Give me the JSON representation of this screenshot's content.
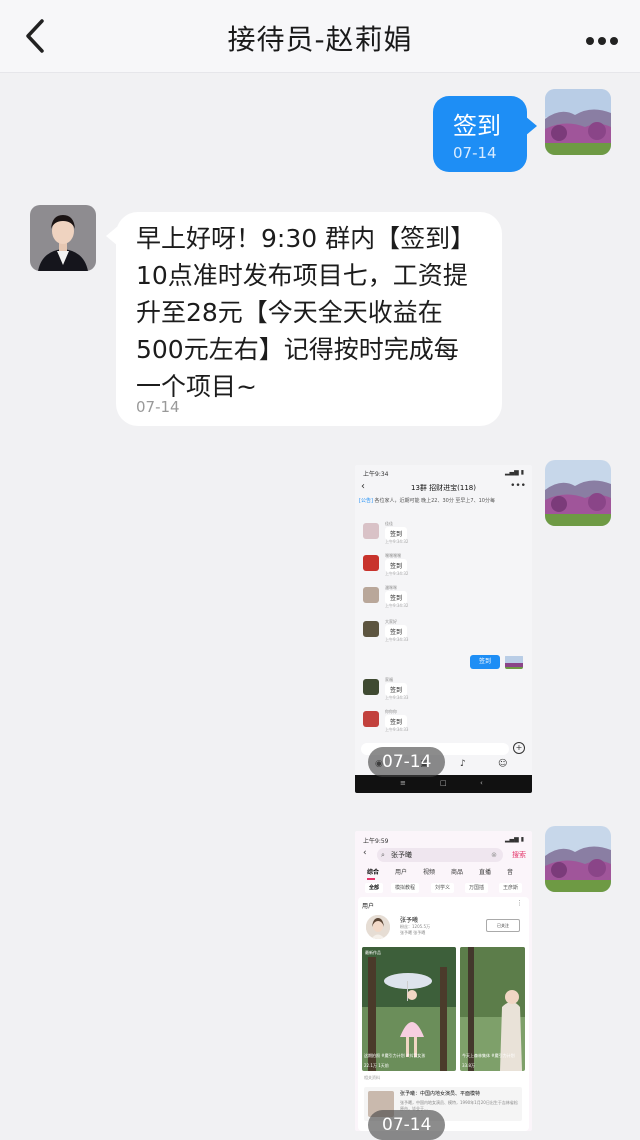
{
  "header": {
    "title": "接待员-赵莉娟"
  },
  "messages": {
    "checkin": {
      "text": "签到",
      "time": "07-14"
    },
    "greeting": {
      "lines": [
        "早上好呀！9:30 群内【签到】",
        "10点准时发布项目七，工资提",
        "升至28元【今天全天收益在",
        "500元左右】记得按时完成每",
        "一个项目~"
      ],
      "time": "07-14"
    },
    "image1_time": "07-14",
    "image2_time": "07-14"
  },
  "screenshot1": {
    "status_time": "上午9:34",
    "title": "13群 招财进宝(118)",
    "notice_tag": "[公告]",
    "notice": "各位家人，近期可能 晚上22、30分 至早上7、10分每",
    "rows": [
      {
        "name": "佳佳",
        "msg": "签到",
        "sub": "上午9:34:32"
      },
      {
        "name": "嘿嘿嘿嘿",
        "msg": "签到",
        "sub": "上午9:34:32"
      },
      {
        "name": "潘咪咪",
        "msg": "签到",
        "sub": "上午9:34:32"
      },
      {
        "name": "大家好",
        "msg": "签到",
        "sub": "上午9:34:33"
      },
      {
        "name": "家福",
        "msg": "签到",
        "sub": "上午9:34:33"
      },
      {
        "name": "你你你",
        "msg": "签到",
        "sub": "上午9:34:33"
      }
    ],
    "my_msg": "签到",
    "plus": "+"
  },
  "screenshot2": {
    "status_time": "上午9:59",
    "query": "张予曦",
    "search_btn": "搜索",
    "tabs": [
      "综合",
      "用户",
      "视频",
      "商品",
      "直播",
      "音"
    ],
    "chips": [
      "全部",
      "模拟教程",
      "刘学义",
      "万国插",
      "王彦斯"
    ],
    "section": "用户",
    "user_name": "张予曦",
    "user_fans": "粉丝：1205.5万",
    "user_sub": "张予曦 张予曦",
    "follow": "已关注",
    "video1_tag": "最新作品",
    "video1_caption": "这期拍照 #魔引力计划 #抖音女孩",
    "video1_likes": "22.1万",
    "video1_date": "1天前",
    "video2_caption": "今天上森林集体 #魔引力计划",
    "video2_likes": "33.8万",
    "related_label": "相关资料",
    "related_title": "张予曦：中国内地女演员、平面模特",
    "related_desc": "张予曦，中国内地女演员、模特，1990年1月20日出生于吉林省松原市，毕业于..."
  }
}
